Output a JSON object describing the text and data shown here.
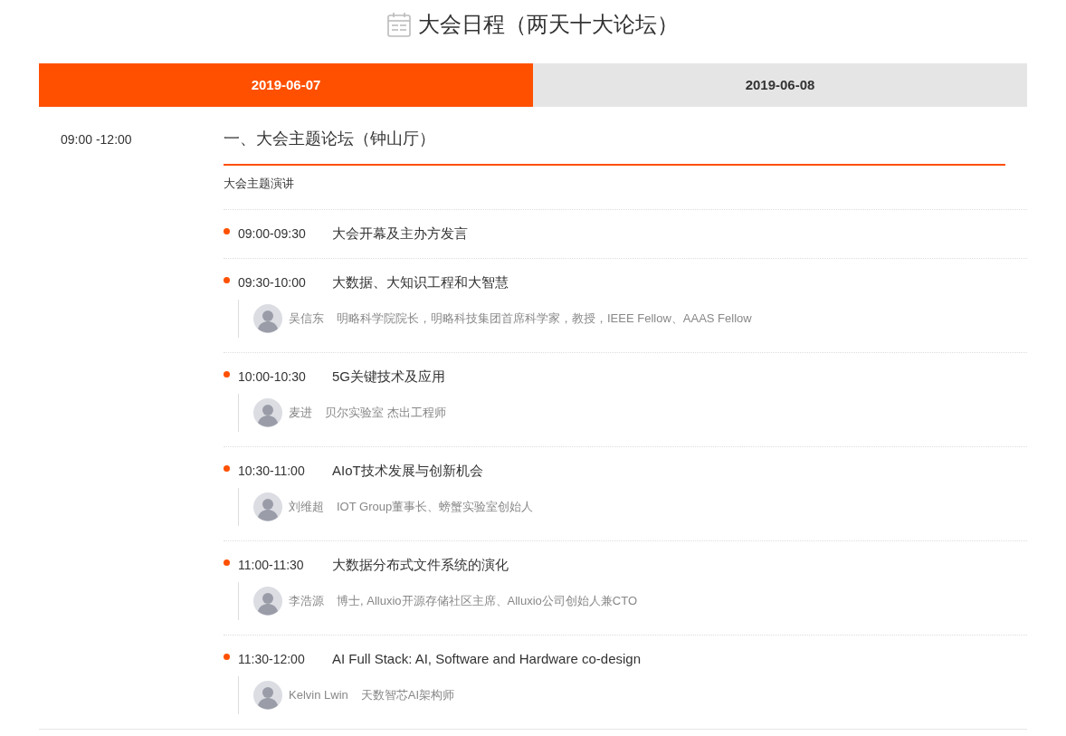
{
  "title": "大会日程（两天十大论坛）",
  "tabs": [
    {
      "label": "2019-06-07",
      "selected": true
    },
    {
      "label": "2019-06-08",
      "selected": false
    }
  ],
  "block": {
    "time": "09:00 -12:00",
    "heading": "一、大会主题论坛（钟山厅）",
    "subheading": "大会主题演讲",
    "sessions": [
      {
        "time": "09:00-09:30",
        "topic": "大会开幕及主办方发言"
      },
      {
        "time": "09:30-10:00",
        "topic": "大数据、大知识工程和大智慧",
        "speakers": [
          {
            "name": "吴信东",
            "bio": "明略科学院院长，明略科技集团首席科学家，教授，IEEE Fellow、AAAS Fellow"
          }
        ]
      },
      {
        "time": "10:00-10:30",
        "topic": "5G关键技术及应用",
        "speakers": [
          {
            "name": "麦进",
            "bio": "贝尔实验室 杰出工程师"
          }
        ]
      },
      {
        "time": "10:30-11:00",
        "topic": "AIoT技术发展与创新机会",
        "speakers": [
          {
            "name": "刘维超",
            "bio": "IOT Group董事长、螃蟹实验室创始人"
          }
        ]
      },
      {
        "time": "11:00-11:30",
        "topic": "大数据分布式文件系统的演化",
        "speakers": [
          {
            "name": "李浩源",
            "bio": "博士, Alluxio开源存储社区主席、Alluxio公司创始人兼CTO"
          }
        ]
      },
      {
        "time": "11:30-12:00",
        "topic": "AI Full Stack: AI, Software and Hardware co-design",
        "speakers": [
          {
            "name": "Kelvin Lwin",
            "bio": "天数智芯AI架构师"
          }
        ]
      }
    ]
  }
}
